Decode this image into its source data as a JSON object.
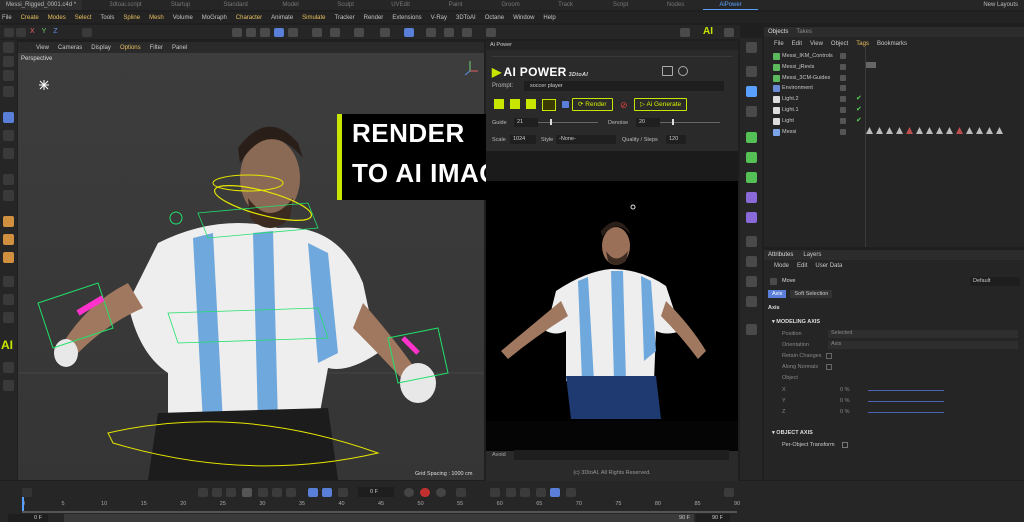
{
  "tabbar": {
    "doc_title": "Messi_Rigged_0001.c4d *",
    "layouts": [
      "3dtoai.script",
      "Startup",
      "Standard",
      "Model",
      "Sculpt",
      "UVEdit",
      "Paint",
      "Groom",
      "Track",
      "Script",
      "Nodes",
      "AiPower"
    ],
    "active_layout": "AiPower",
    "new_layouts": "New Layouts"
  },
  "menubar": {
    "items": [
      "File",
      "Create",
      "Modes",
      "Select",
      "Tools",
      "Spline",
      "Mesh",
      "Volume",
      "MoGraph",
      "Character",
      "Animate",
      "Simulate",
      "Tracker",
      "Render",
      "Extensions",
      "V-Ray",
      "3DToAI",
      "Octane",
      "Window",
      "Help"
    ]
  },
  "toolbar": {
    "axis_letters": [
      "X",
      "Y",
      "Z"
    ]
  },
  "viewport": {
    "menu": [
      "View",
      "Cameras",
      "Display",
      "Options",
      "Filter",
      "Panel"
    ],
    "camera": "Perspective",
    "grid_spacing": "Grid Spacing : 1000 cm"
  },
  "overlay": {
    "line1": "RENDER",
    "line2": "TO AI IMAGE"
  },
  "ai_panel": {
    "title": "Ai Power",
    "logo": "AI POWER",
    "logo_sub": "3DtoAI",
    "prompt_label": "Prompt:",
    "prompt_value": "soccer player",
    "render_label": "Render",
    "generate_label": "Ai Generate",
    "guide_label": "Guide",
    "guide_value": "21",
    "denoise_label": "Denoise",
    "denoise_value": "20",
    "scale_label": "Scale",
    "scale_value": "1024",
    "style_label": "Style",
    "style_value": "-None-",
    "quality_label": "Quality / Steps",
    "quality_value": "120",
    "avoid_label": "Avoid",
    "copyright": "(c) 3DtoAI. All Rights Reserved."
  },
  "objects_panel": {
    "tabs": [
      "Objects",
      "Takes"
    ],
    "menu": [
      "File",
      "Edit",
      "View",
      "Object",
      "Tags",
      "Bookmarks"
    ],
    "rows": [
      {
        "name": "Messi_IKM_Controls",
        "icon_color": "#5cb85c",
        "check": ""
      },
      {
        "name": "Messi_jRevis",
        "icon_color": "#5cb85c",
        "check": ""
      },
      {
        "name": "Messi_3CM-Guides",
        "icon_color": "#5cb85c",
        "check": ""
      },
      {
        "name": "Environment",
        "icon_color": "#6a8cd8",
        "check": ""
      },
      {
        "name": "Light.2",
        "icon_color": "#dddddd",
        "check": "✔"
      },
      {
        "name": "Light.1",
        "icon_color": "#dddddd",
        "check": "✔"
      },
      {
        "name": "Light",
        "icon_color": "#dddddd",
        "check": "✔"
      },
      {
        "name": "Messi",
        "icon_color": "#7aa3e8",
        "check": ""
      }
    ]
  },
  "attributes_panel": {
    "tabs": [
      "Attributes",
      "Layers"
    ],
    "menu": [
      "Mode",
      "Edit",
      "User Data"
    ],
    "tool": "Move",
    "preset": "Default",
    "subtabs": [
      "Axis",
      "Soft Selection"
    ],
    "section": "Axis",
    "modeling_axis": "MODELING AXIS",
    "position_label": "Position",
    "position_value": "Selected",
    "orientation_label": "Orientation",
    "orientation_value": "Axis",
    "retain_changes": "Retain Changes",
    "along_normals": "Along Normals",
    "object_label": "Object",
    "xyz": [
      "X",
      "Y",
      "Z"
    ],
    "pct": [
      "0 %",
      "0 %",
      "0 %"
    ],
    "object_axis": "OBJECT AXIS",
    "per_object": "Per-Object Transform"
  },
  "timeline": {
    "ticks": [
      "0",
      "5",
      "10",
      "15",
      "20",
      "25",
      "30",
      "35",
      "40",
      "45",
      "50",
      "55",
      "60",
      "65",
      "70",
      "75",
      "80",
      "85",
      "90"
    ],
    "current_frame": "0 F",
    "start": "0 F",
    "end": "90 F",
    "end2": "90 F"
  },
  "colors": {
    "accent": "#c8e600",
    "highlight": "#e8c060",
    "active_tab": "#5aa0ff"
  }
}
